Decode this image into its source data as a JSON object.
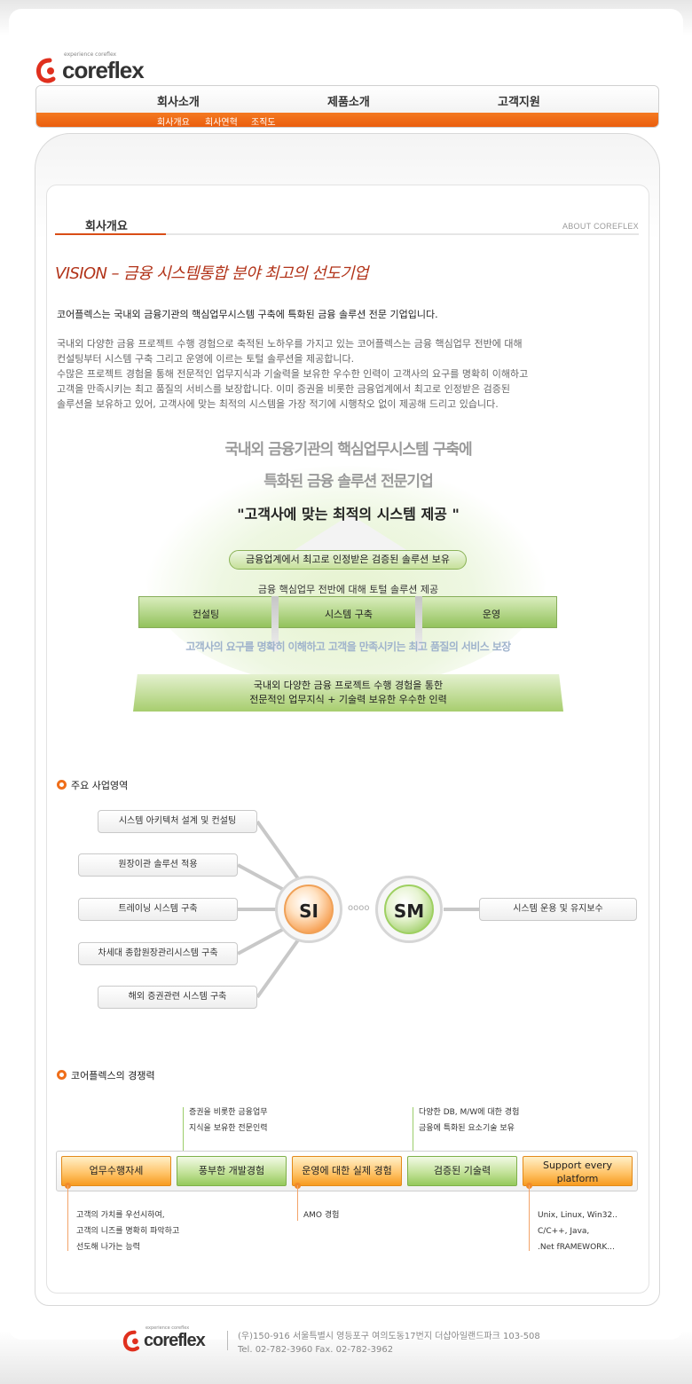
{
  "brand": {
    "tagline": "experience coreflex",
    "name": "coreflex"
  },
  "nav": {
    "main": [
      "회사소개",
      "제품소개",
      "고객지원"
    ],
    "sub": [
      "회사개요",
      "회사연혁",
      "조직도"
    ]
  },
  "page": {
    "title": "회사개요",
    "about": "ABOUT COREFLEX",
    "vision": "VISION – 금융 시스템통합 분야 최고의 선도기업",
    "lead": "코어플렉스는 국내외 금융기관의 핵심업무시스템 구축에 특화된 금융 솔루션 전문 기업입니다.",
    "body": [
      "국내외 다양한 금융 프로젝트 수행 경험으로 축적된 노하우를 가지고 있는 코어플렉스는 금융 핵심업무 전반에 대해",
      "컨설팅부터 시스템  구축 그리고 운영에 이르는 토털 솔루션을 제공합니다.",
      "수많은 프로젝트 경험을 통해 전문적인 업무지식과 기술력을 보유한 우수한 인력이 고객사의 요구를 명확히 이해하고",
      "고객을 만족시키는 최고 품질의 서비스를 보장합니다. 이미 증권을 비롯한 금융업계에서 최고로 인정받은 검증된",
      "솔루션을 보유하고 있어, 고객사에 맞는 최적의 시스템을 가장 적기에 시행착오 없이 제공해 드리고 있습니다."
    ]
  },
  "vision_diagram": {
    "top_lines": [
      "국내외 금융기관의 핵심업무시스템 구축에",
      "특화된 금융 솔루션 전문기업"
    ],
    "quote": "\"고객사에 맞는 최적의 시스템 제공 \"",
    "pill": "금융업계에서 최고로 인정받은 검증된 솔루션 보유",
    "total_line": "금융 핵심업무 전반에 대해 토털 솔루션 제공",
    "bar_cells": [
      "컨설팅",
      "시스템 구축",
      "운영"
    ],
    "service_line": "고객사의 요구를 명확히 이해하고 고객을 만족시키는 최고 품질의 서비스 보장",
    "base_lines": [
      "국내외 다양한 금융 프로젝트 수행 경험을 통한",
      "전문적인 업무지식 + 기술력 보유한 우수한 인력"
    ]
  },
  "business": {
    "heading": "주요 사업영역",
    "si_items": [
      "시스템 아키텍처 설계 및 컨설팅",
      "원장이관 솔루션 적용",
      "트레이닝 시스템 구축",
      "차세대 종합원장관리시스템 구축",
      "해외 증권관련 시스템 구축"
    ],
    "si_label": "SI",
    "sm_label": "SM",
    "sm_item": "시스템 운용 및 유지보수"
  },
  "competitiveness": {
    "heading": "코어플렉스의 경쟁력",
    "buttons": [
      "업무수행자세",
      "풍부한 개발경험",
      "운영에 대한 실제 경험",
      "검증된 기술력",
      "Support every platform"
    ],
    "top_notes": [
      [
        "증권을 비롯한 금융업무",
        "지식을 보유한 전문인력"
      ],
      [
        "다양한 DB, M/W에 대한 경험",
        "금융에 특화된 요소기술 보유"
      ]
    ],
    "bottom_notes": [
      [
        "고객의 가치를 우선시하여,",
        "고객의 니즈를 명확히 파악하고",
        "선도해 나가는 능력"
      ],
      [
        "AMO 경험"
      ],
      [
        "Unix, Linux, Win32..",
        "C/C++, Java,",
        ".Net fRAMEWORK..."
      ]
    ]
  },
  "footer": {
    "tagline": "experience coreflex",
    "name": "coreflex",
    "address": "(우)150-916 서울특별시 영등포구 여의도동17번지 더샵아일랜드파크 103-508",
    "tel": "Tel. 02-782-3960   Fax. 02-782-3962"
  },
  "colors": {
    "accent": "#e95a0c",
    "vision": "#b2341a",
    "green": "#8bc34a"
  }
}
